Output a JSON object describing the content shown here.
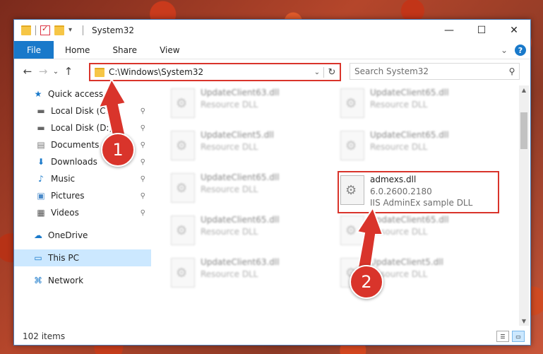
{
  "window": {
    "title": "System32",
    "controls": {
      "minimize": "—",
      "maximize": "☐",
      "close": "✕"
    }
  },
  "ribbon": {
    "tabs": [
      "File",
      "Home",
      "Share",
      "View"
    ],
    "expand_glyph": "⌄",
    "help_glyph": "?"
  },
  "navigation": {
    "back_glyph": "←",
    "forward_glyph": "→",
    "recent_glyph": "⌄",
    "up_glyph": "↑",
    "address": "C:\\Windows\\System32",
    "refresh_glyph": "↻",
    "search_placeholder": "Search System32"
  },
  "sidebar": {
    "items": [
      {
        "label": "Quick access",
        "icon": "star-icon",
        "glyph": "★",
        "pinned": false
      },
      {
        "label": "Local Disk (C:)",
        "icon": "drive-icon",
        "glyph": "▬",
        "pinned": true
      },
      {
        "label": "Local Disk (D:)",
        "icon": "drive-icon",
        "glyph": "▬",
        "pinned": true
      },
      {
        "label": "Documents",
        "icon": "documents-icon",
        "glyph": "▤",
        "pinned": true
      },
      {
        "label": "Downloads",
        "icon": "download-icon",
        "glyph": "⬇",
        "pinned": true
      },
      {
        "label": "Music",
        "icon": "music-icon",
        "glyph": "♪",
        "pinned": true
      },
      {
        "label": "Pictures",
        "icon": "pictures-icon",
        "glyph": "▣",
        "pinned": true
      },
      {
        "label": "Videos",
        "icon": "videos-icon",
        "glyph": "▦",
        "pinned": true
      },
      {
        "label": "OneDrive",
        "icon": "cloud-icon",
        "glyph": "☁",
        "pinned": false
      },
      {
        "label": "This PC",
        "icon": "computer-icon",
        "glyph": "▭",
        "pinned": false
      },
      {
        "label": "Network",
        "icon": "network-icon",
        "glyph": "⌘",
        "pinned": false
      }
    ],
    "pin_glyph": "📌"
  },
  "files": [
    {
      "name": "UpdateClient63.dll",
      "desc": "Resource DLL"
    },
    {
      "name": "UpdateClient65.dll",
      "desc": "Resource DLL"
    },
    {
      "name": "UpdateClient5.dll",
      "desc": "Resource DLL"
    },
    {
      "name": "UpdateClient65.dll",
      "desc": "Resource DLL"
    },
    {
      "name": "UpdateClient65.dll",
      "desc": "Resource DLL"
    },
    {
      "name": "admexs.dll",
      "version": "6.0.2600.2180",
      "desc": "IIS AdminEx sample DLL"
    },
    {
      "name": "UpdateClient65.dll",
      "desc": "Resource DLL"
    },
    {
      "name": "UpdateClient65.dll",
      "desc": "Resource DLL"
    },
    {
      "name": "UpdateClient63.dll",
      "desc": "Resource DLL"
    },
    {
      "name": "UpdateClient5.dll",
      "desc": "Resource DLL"
    }
  ],
  "status": {
    "item_count": "102 items"
  },
  "annotations": {
    "step1": "1",
    "step2": "2"
  },
  "colors": {
    "accent": "#1979ca",
    "highlight": "#d9342b",
    "selected": "#cce8ff"
  }
}
